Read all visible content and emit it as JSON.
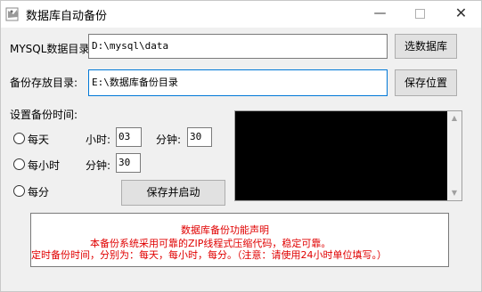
{
  "window": {
    "title": "数据库自动备份",
    "min_glyph": "—",
    "close_glyph": "✕"
  },
  "mysql_dir": {
    "label": "MYSQL数据目录:",
    "value": "D:\\mysql\\data",
    "button": "选数据库"
  },
  "backup_dir": {
    "label": "备份存放目录:",
    "value": "E:\\数据库备份目录",
    "button": "保存位置"
  },
  "schedule": {
    "heading": "设置备份时间:",
    "daily": {
      "label": "每天",
      "hour_label": "小时:",
      "hour_value": "03",
      "minute_label": "分钟:",
      "minute_value": "30"
    },
    "hourly": {
      "label": "每小时",
      "minute_label": "分钟:",
      "minute_value": "30"
    },
    "per_minute": {
      "label": "每分"
    },
    "start_button": "保存并启动"
  },
  "notice": {
    "line1": "数据库备份功能声明",
    "line2": "本备份系统采用可靠的ZIP线程式压缩代码，稳定可靠。",
    "line3": "定时备份时间，分别为：每天，每小时，每分。（注意：请使用24小时单位填写。）"
  },
  "colors": {
    "notice_text": "#e00000",
    "focus_border": "#0078d7",
    "log_bg": "#000000"
  },
  "icons": {
    "app": "database-icon",
    "scroll_up": "chevron-up-icon",
    "scroll_down": "chevron-down-icon"
  }
}
